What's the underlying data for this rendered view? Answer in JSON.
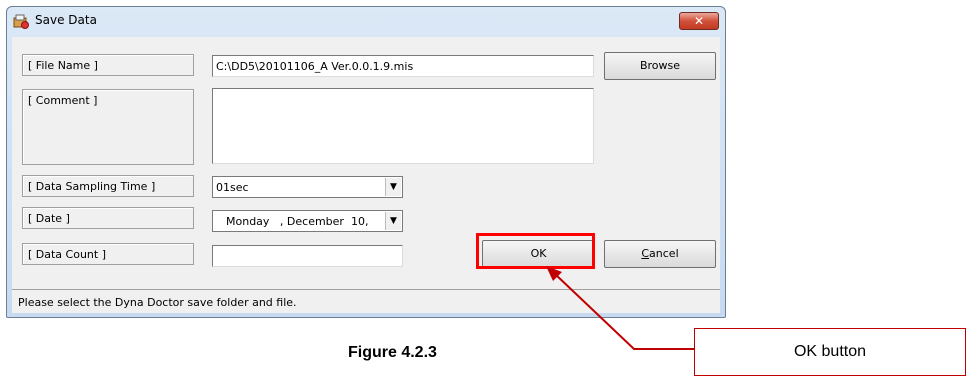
{
  "window": {
    "title": "Save Data",
    "close_glyph": "✕"
  },
  "labels": {
    "file_name": "[ File Name ]",
    "comment": "[ Comment ]",
    "sampling_time": "[ Data Sampling Time ]",
    "date": "[ Date ]",
    "data_count": "[ Data Count ]"
  },
  "fields": {
    "file_name": "C:\\DD5\\20101106_A Ver.0.0.1.9.mis",
    "comment": "",
    "sampling_time": "01sec",
    "date": "Monday   , December  10,",
    "data_count": ""
  },
  "buttons": {
    "browse": "Browse",
    "ok": "OK",
    "cancel": "Cancel"
  },
  "status": "Please select the Dyna Doctor save folder and file.",
  "annotation": {
    "caption": "Figure 4.2.3",
    "callout": "OK button",
    "highlight_color": "#ff0000"
  },
  "icons": {
    "app": "save-data-icon",
    "dropdown": "▼"
  }
}
